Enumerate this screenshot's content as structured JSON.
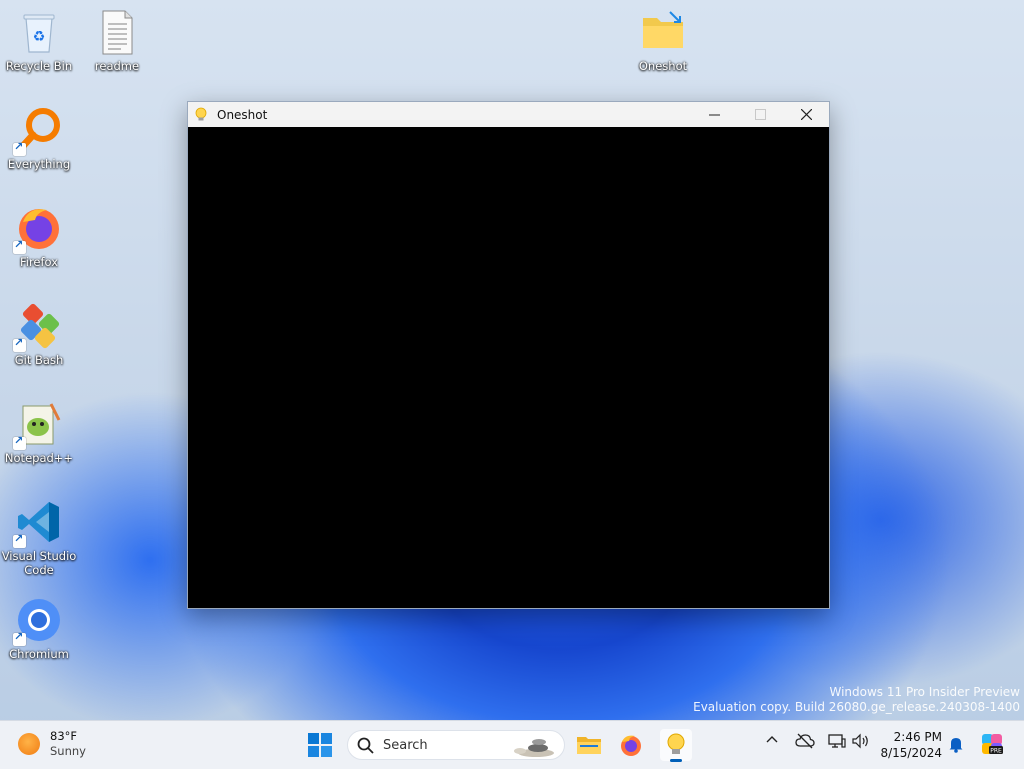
{
  "desktop": {
    "icons": [
      {
        "label": "Recycle Bin",
        "icon": "recycle-bin-icon"
      },
      {
        "label": "readme",
        "icon": "text-file-icon"
      },
      {
        "label": "Oneshot",
        "icon": "folder-icon"
      },
      {
        "label": "Everything",
        "icon": "everything-search-icon"
      },
      {
        "label": "Firefox",
        "icon": "firefox-icon"
      },
      {
        "label": "Git Bash",
        "icon": "git-bash-icon"
      },
      {
        "label": "Notepad++",
        "icon": "notepadpp-icon"
      },
      {
        "label": "Visual Studio Code",
        "icon": "vscode-icon"
      },
      {
        "label": "Chromium",
        "icon": "chromium-icon"
      }
    ]
  },
  "window": {
    "title": "Oneshot",
    "icon": "lightbulb-icon",
    "controls": {
      "minimize": "—",
      "maximize": "☐",
      "close": "✕"
    }
  },
  "watermark": {
    "line1": "Windows 11 Pro Insider Preview",
    "line2": "Evaluation copy. Build 26080.ge_release.240308-1400"
  },
  "taskbar": {
    "weather": {
      "temp": "83°F",
      "condition": "Sunny"
    },
    "search_placeholder": "Search",
    "pinned": [
      "start-icon",
      "file-explorer-icon",
      "firefox-icon",
      "lightbulb-icon"
    ],
    "tray": {
      "chevron": "^",
      "time": "2:46 PM",
      "date": "8/15/2024"
    }
  },
  "colors": {
    "accent": "#005fb8",
    "window_bg": "#000000",
    "titlebar": "#f3f3f3"
  }
}
